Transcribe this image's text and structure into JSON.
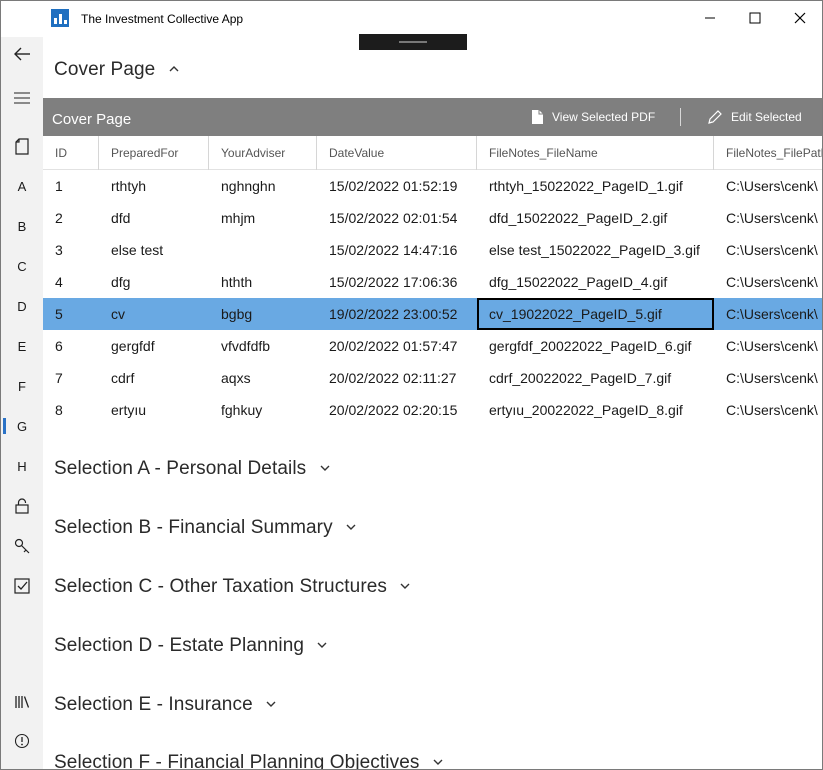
{
  "window": {
    "title": "The Investment Collective App",
    "minimize_glyph": "—",
    "maximize_glyph": "☐",
    "close_glyph": "✕"
  },
  "nav": {
    "back_glyph": "←",
    "menu_glyph": "≡",
    "letters": [
      "A",
      "B",
      "C",
      "D",
      "E",
      "F",
      "G",
      "H"
    ],
    "active_letter": "G",
    "icons": [
      "page-icon",
      "lock-icon",
      "key-icon",
      "checkbox-icon",
      "library-icon",
      "info-icon"
    ]
  },
  "cover": {
    "header": "Cover Page",
    "header_chevron": "⌃"
  },
  "commandbar": {
    "title": "Cover Page",
    "view_pdf_label": "View Selected PDF",
    "edit_label": "Edit Selected"
  },
  "grid": {
    "columns": [
      "ID",
      "PreparedFor",
      "YourAdviser",
      "DateValue",
      "FileNotes_FileName",
      "FileNotes_FilePath"
    ],
    "rows": [
      [
        "1",
        "rthtyh",
        "nghnghn",
        "15/02/2022 01:52:19",
        "rthtyh_15022022_PageID_1.gif",
        "C:\\Users\\cenk\\"
      ],
      [
        "2",
        "dfd",
        "mhjm",
        "15/02/2022 02:01:54",
        "dfd_15022022_PageID_2.gif",
        "C:\\Users\\cenk\\"
      ],
      [
        "3",
        "else test",
        "",
        "15/02/2022 14:47:16",
        "else test_15022022_PageID_3.gif",
        "C:\\Users\\cenk\\"
      ],
      [
        "4",
        "dfg",
        "hthth",
        "15/02/2022 17:06:36",
        "dfg_15022022_PageID_4.gif",
        "C:\\Users\\cenk\\"
      ],
      [
        "5",
        " cv",
        "bgbg",
        "19/02/2022 23:00:52",
        " cv_19022022_PageID_5.gif",
        "C:\\Users\\cenk\\"
      ],
      [
        "6",
        "gergfdf",
        "vfvdfdfb",
        "20/02/2022 01:57:47",
        "gergfdf_20022022_PageID_6.gif",
        "C:\\Users\\cenk\\"
      ],
      [
        "7",
        "cdrf",
        "aqxs",
        "20/02/2022 02:11:27",
        "cdrf_20022022_PageID_7.gif",
        "C:\\Users\\cenk\\"
      ],
      [
        "8",
        "ertyıu",
        "fghkuy",
        "20/02/2022 02:20:15",
        "ertyıu_20022022_PageID_8.gif",
        "C:\\Users\\cenk\\"
      ]
    ],
    "selected_row_index": 4,
    "focused_column_index": 4
  },
  "sections": [
    "Selection A - Personal Details",
    "Selection B - Financial Summary",
    "Selection C - Other Taxation Structures",
    "Selection D - Estate Planning",
    "Selection E - Insurance",
    "Selection F - Financial Planning Objectives"
  ],
  "section_chevron": "⌄",
  "colors": {
    "selected_row": "#69a9e3",
    "command_bar": "#7f7f7f",
    "nav_background": "#f2f2f2",
    "accent": "#2a72c6"
  }
}
